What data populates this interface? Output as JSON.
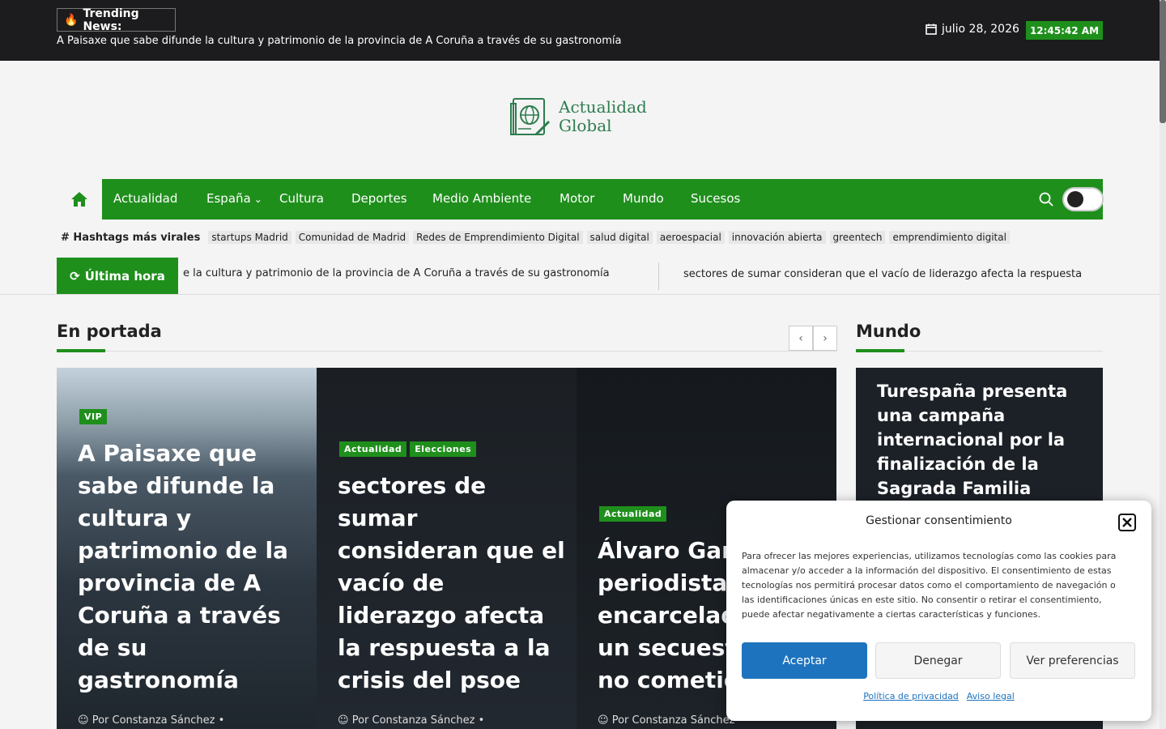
{
  "topbar": {
    "trending_label": "Trending News:",
    "trending_text": "A Paisaxe que sabe difunde la cultura y patrimonio de la provincia de A Coruña a través de su gastronomía",
    "date": "julio 28, 2026",
    "time": "12:45:42 AM"
  },
  "logo": {
    "line1": "Actualidad",
    "line2": "Global"
  },
  "nav": {
    "items": [
      "Actualidad",
      "España",
      "Cultura",
      "Deportes",
      "Medio Ambiente",
      "Motor",
      "Mundo",
      "Sucesos"
    ]
  },
  "hashtags": {
    "title": "# Hashtags más virales",
    "tags": [
      "startups Madrid",
      "Comunidad de Madrid",
      "Redes de Emprendimiento Digital",
      "salud digital",
      "aeroespacial",
      "innovación abierta",
      "greentech",
      "emprendimiento digital"
    ]
  },
  "breaking": {
    "label": "Última hora",
    "text1": "e la cultura y patrimonio de la provincia de A Coruña a través de su gastronomía",
    "text2": "sectores de sumar consideran que el vacío de liderazgo afecta la respuesta"
  },
  "featured": {
    "title": "En portada",
    "cards": [
      {
        "cats": [
          "VIP"
        ],
        "title": "A Paisaxe que sabe difunde la cultura y patrimonio de la provincia de A Coruña a través de su gastronomía",
        "author": "Por Constanza Sánchez"
      },
      {
        "cats": [
          "Actualidad",
          "Elecciones"
        ],
        "title": "sectores de sumar consideran que el vacío de liderazgo afecta la respuesta a la crisis del psoe",
        "author": "Por Constanza Sánchez"
      },
      {
        "cats": [
          "Actualidad"
        ],
        "title": "Álvaro García, periodista encarcelado por un secuestro que no cometió",
        "author": "Por Constanza Sánchez"
      }
    ]
  },
  "sidebar": {
    "title": "Mundo",
    "card_title": "Turespaña presenta una campaña internacional por la finalización de la Sagrada Familia"
  },
  "consent": {
    "title": "Gestionar consentimiento",
    "body": "Para ofrecer las mejores experiencias, utilizamos tecnologías como las cookies para almacenar y/o acceder a la información del dispositivo. El consentimiento de estas tecnologías nos permitirá procesar datos como el comportamiento de navegación o las identificaciones únicas en este sitio. No consentir o retirar el consentimiento, puede afectar negativamente a ciertas características y funciones.",
    "accept": "Aceptar",
    "deny": "Denegar",
    "preferences": "Ver preferencias",
    "privacy_link": "Política de privacidad",
    "legal_link": "Aviso legal"
  },
  "colors": {
    "brand_green": "#1f8f1c",
    "accept_blue": "#1e73be",
    "topbar": "#1c1c1e"
  }
}
